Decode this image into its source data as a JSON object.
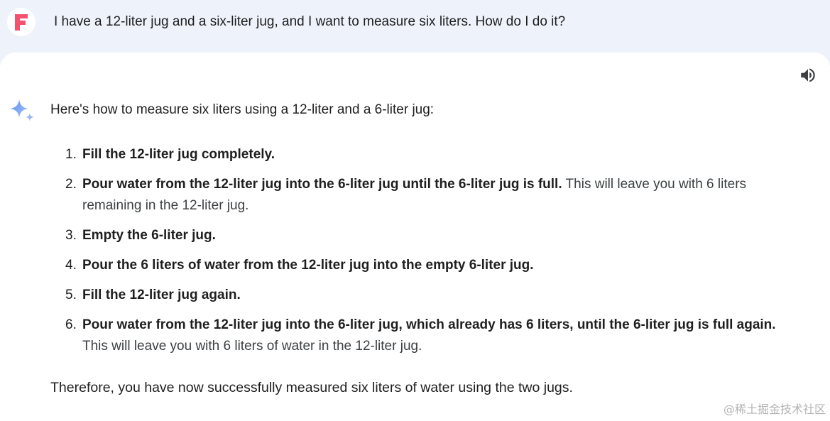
{
  "prompt": {
    "text": "I have a 12-liter jug and a six-liter jug, and I want to measure six liters. How do I do it?"
  },
  "response": {
    "intro": "Here's how to measure six liters using a 12-liter and a 6-liter jug:",
    "steps": [
      {
        "num": "1.",
        "bold": "Fill the 12-liter jug completely.",
        "rest": ""
      },
      {
        "num": "2.",
        "bold": "Pour water from the 12-liter jug into the 6-liter jug until the 6-liter jug is full.",
        "rest": " This will leave you with 6 liters remaining in the 12-liter jug."
      },
      {
        "num": "3.",
        "bold": "Empty the 6-liter jug.",
        "rest": ""
      },
      {
        "num": "4.",
        "bold": "Pour the 6 liters of water from the 12-liter jug into the empty 6-liter jug.",
        "rest": ""
      },
      {
        "num": "5.",
        "bold": "Fill the 12-liter jug again.",
        "rest": ""
      },
      {
        "num": "6.",
        "bold": "Pour water from the 12-liter jug into the 6-liter jug, which already has 6 liters, until the 6-liter jug is full again.",
        "rest": " This will leave you with 6 liters of water in the 12-liter jug."
      }
    ],
    "conclusion": "Therefore, you have now successfully measured six liters of water using the two jugs."
  },
  "watermark": "@稀土掘金技术社区",
  "icons": {
    "user_avatar": "avatar-icon",
    "read_aloud": "speaker-icon",
    "assistant": "sparkle-icon"
  },
  "colors": {
    "prompt_background": "#eef2fb",
    "avatar_accent": "#f4516c",
    "sparkle_accent": "#7aa7f0"
  }
}
